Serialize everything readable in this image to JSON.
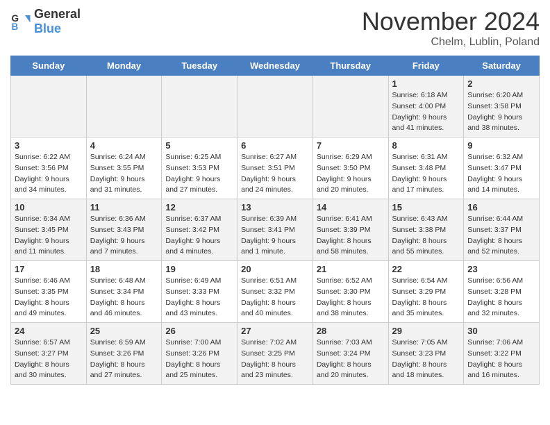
{
  "header": {
    "logo_line1": "General",
    "logo_line2": "Blue",
    "title": "November 2024",
    "location": "Chelm, Lublin, Poland"
  },
  "days_of_week": [
    "Sunday",
    "Monday",
    "Tuesday",
    "Wednesday",
    "Thursday",
    "Friday",
    "Saturday"
  ],
  "weeks": [
    [
      {
        "day": "",
        "info": "",
        "rowtype": "even"
      },
      {
        "day": "",
        "info": "",
        "rowtype": "even"
      },
      {
        "day": "",
        "info": "",
        "rowtype": "even"
      },
      {
        "day": "",
        "info": "",
        "rowtype": "even"
      },
      {
        "day": "",
        "info": "",
        "rowtype": "even"
      },
      {
        "day": "1",
        "info": "Sunrise: 6:18 AM\nSunset: 4:00 PM\nDaylight: 9 hours and 41 minutes.",
        "rowtype": "even"
      },
      {
        "day": "2",
        "info": "Sunrise: 6:20 AM\nSunset: 3:58 PM\nDaylight: 9 hours and 38 minutes.",
        "rowtype": "even"
      }
    ],
    [
      {
        "day": "3",
        "info": "Sunrise: 6:22 AM\nSunset: 3:56 PM\nDaylight: 9 hours and 34 minutes.",
        "rowtype": "odd"
      },
      {
        "day": "4",
        "info": "Sunrise: 6:24 AM\nSunset: 3:55 PM\nDaylight: 9 hours and 31 minutes.",
        "rowtype": "odd"
      },
      {
        "day": "5",
        "info": "Sunrise: 6:25 AM\nSunset: 3:53 PM\nDaylight: 9 hours and 27 minutes.",
        "rowtype": "odd"
      },
      {
        "day": "6",
        "info": "Sunrise: 6:27 AM\nSunset: 3:51 PM\nDaylight: 9 hours and 24 minutes.",
        "rowtype": "odd"
      },
      {
        "day": "7",
        "info": "Sunrise: 6:29 AM\nSunset: 3:50 PM\nDaylight: 9 hours and 20 minutes.",
        "rowtype": "odd"
      },
      {
        "day": "8",
        "info": "Sunrise: 6:31 AM\nSunset: 3:48 PM\nDaylight: 9 hours and 17 minutes.",
        "rowtype": "odd"
      },
      {
        "day": "9",
        "info": "Sunrise: 6:32 AM\nSunset: 3:47 PM\nDaylight: 9 hours and 14 minutes.",
        "rowtype": "odd"
      }
    ],
    [
      {
        "day": "10",
        "info": "Sunrise: 6:34 AM\nSunset: 3:45 PM\nDaylight: 9 hours and 11 minutes.",
        "rowtype": "even"
      },
      {
        "day": "11",
        "info": "Sunrise: 6:36 AM\nSunset: 3:43 PM\nDaylight: 9 hours and 7 minutes.",
        "rowtype": "even"
      },
      {
        "day": "12",
        "info": "Sunrise: 6:37 AM\nSunset: 3:42 PM\nDaylight: 9 hours and 4 minutes.",
        "rowtype": "even"
      },
      {
        "day": "13",
        "info": "Sunrise: 6:39 AM\nSunset: 3:41 PM\nDaylight: 9 hours and 1 minute.",
        "rowtype": "even"
      },
      {
        "day": "14",
        "info": "Sunrise: 6:41 AM\nSunset: 3:39 PM\nDaylight: 8 hours and 58 minutes.",
        "rowtype": "even"
      },
      {
        "day": "15",
        "info": "Sunrise: 6:43 AM\nSunset: 3:38 PM\nDaylight: 8 hours and 55 minutes.",
        "rowtype": "even"
      },
      {
        "day": "16",
        "info": "Sunrise: 6:44 AM\nSunset: 3:37 PM\nDaylight: 8 hours and 52 minutes.",
        "rowtype": "even"
      }
    ],
    [
      {
        "day": "17",
        "info": "Sunrise: 6:46 AM\nSunset: 3:35 PM\nDaylight: 8 hours and 49 minutes.",
        "rowtype": "odd"
      },
      {
        "day": "18",
        "info": "Sunrise: 6:48 AM\nSunset: 3:34 PM\nDaylight: 8 hours and 46 minutes.",
        "rowtype": "odd"
      },
      {
        "day": "19",
        "info": "Sunrise: 6:49 AM\nSunset: 3:33 PM\nDaylight: 8 hours and 43 minutes.",
        "rowtype": "odd"
      },
      {
        "day": "20",
        "info": "Sunrise: 6:51 AM\nSunset: 3:32 PM\nDaylight: 8 hours and 40 minutes.",
        "rowtype": "odd"
      },
      {
        "day": "21",
        "info": "Sunrise: 6:52 AM\nSunset: 3:30 PM\nDaylight: 8 hours and 38 minutes.",
        "rowtype": "odd"
      },
      {
        "day": "22",
        "info": "Sunrise: 6:54 AM\nSunset: 3:29 PM\nDaylight: 8 hours and 35 minutes.",
        "rowtype": "odd"
      },
      {
        "day": "23",
        "info": "Sunrise: 6:56 AM\nSunset: 3:28 PM\nDaylight: 8 hours and 32 minutes.",
        "rowtype": "odd"
      }
    ],
    [
      {
        "day": "24",
        "info": "Sunrise: 6:57 AM\nSunset: 3:27 PM\nDaylight: 8 hours and 30 minutes.",
        "rowtype": "even"
      },
      {
        "day": "25",
        "info": "Sunrise: 6:59 AM\nSunset: 3:26 PM\nDaylight: 8 hours and 27 minutes.",
        "rowtype": "even"
      },
      {
        "day": "26",
        "info": "Sunrise: 7:00 AM\nSunset: 3:26 PM\nDaylight: 8 hours and 25 minutes.",
        "rowtype": "even"
      },
      {
        "day": "27",
        "info": "Sunrise: 7:02 AM\nSunset: 3:25 PM\nDaylight: 8 hours and 23 minutes.",
        "rowtype": "even"
      },
      {
        "day": "28",
        "info": "Sunrise: 7:03 AM\nSunset: 3:24 PM\nDaylight: 8 hours and 20 minutes.",
        "rowtype": "even"
      },
      {
        "day": "29",
        "info": "Sunrise: 7:05 AM\nSunset: 3:23 PM\nDaylight: 8 hours and 18 minutes.",
        "rowtype": "even"
      },
      {
        "day": "30",
        "info": "Sunrise: 7:06 AM\nSunset: 3:22 PM\nDaylight: 8 hours and 16 minutes.",
        "rowtype": "even"
      }
    ]
  ]
}
